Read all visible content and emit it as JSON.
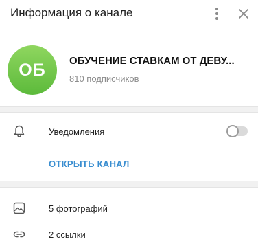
{
  "header": {
    "title": "Информация о канале",
    "menu_icon": "more-vertical-icon",
    "close_icon": "close-icon"
  },
  "channel": {
    "avatar_initials": "ОБ",
    "name": "ОБУЧЕНИЕ СТАВКАМ ОТ ДЕВУ...",
    "subscribers": "810 подписчиков",
    "avatar_color": "#6cc644"
  },
  "notifications": {
    "icon": "bell-icon",
    "label": "Уведомления",
    "enabled": false
  },
  "open_channel": {
    "label": "ОТКРЫТЬ КАНАЛ",
    "color": "#3a8ed0"
  },
  "media": [
    {
      "icon": "photo-icon",
      "label": "5 фотографий"
    },
    {
      "icon": "link-icon",
      "label": "2 ссылки"
    }
  ]
}
